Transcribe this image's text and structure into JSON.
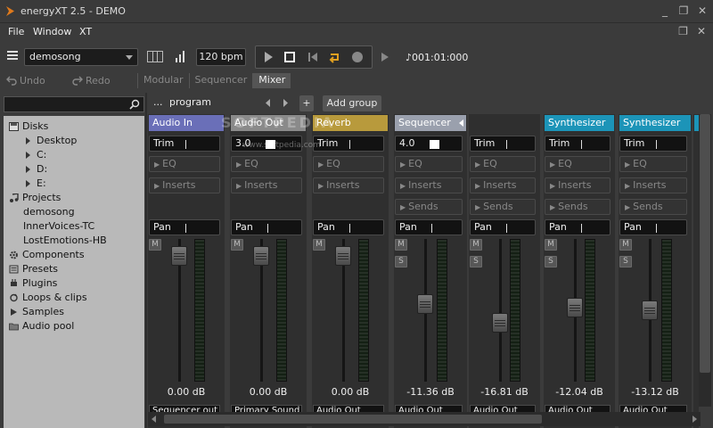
{
  "window": {
    "title": "energyXT 2.5 - DEMO",
    "minimize": "_",
    "restore": "❐",
    "close": "✕"
  },
  "menu": {
    "items": [
      "File",
      "Window",
      "XT"
    ]
  },
  "toolbar": {
    "song": "demosong",
    "bpm": "120 bpm",
    "position": "♪001:01:000"
  },
  "edit": {
    "undo": "Undo",
    "redo": "Redo"
  },
  "views": {
    "tabs": [
      "Modular",
      "Sequencer",
      "Mixer"
    ],
    "active": "Mixer"
  },
  "search": {
    "value": ""
  },
  "browser": {
    "items": [
      {
        "label": "Disks",
        "level": 0,
        "icon": "disk-icon"
      },
      {
        "label": "Desktop",
        "level": 1,
        "icon": "expand-arrow-icon"
      },
      {
        "label": "C:",
        "level": 1,
        "icon": "expand-arrow-icon"
      },
      {
        "label": "D:",
        "level": 1,
        "icon": "expand-arrow-icon"
      },
      {
        "label": "E:",
        "level": 1,
        "icon": "expand-arrow-icon"
      },
      {
        "label": "Projects",
        "level": 0,
        "icon": "music-note-icon"
      },
      {
        "label": "demosong",
        "level": 1,
        "icon": ""
      },
      {
        "label": "InnerVoices-TC",
        "level": 1,
        "icon": ""
      },
      {
        "label": "LostEmotions-HB",
        "level": 1,
        "icon": ""
      },
      {
        "label": "Components",
        "level": 0,
        "icon": "gear-icon"
      },
      {
        "label": "Presets",
        "level": 0,
        "icon": "list-icon"
      },
      {
        "label": "Plugins",
        "level": 0,
        "icon": "plug-icon"
      },
      {
        "label": "Loops & clips",
        "level": 0,
        "icon": "loop-icon"
      },
      {
        "label": "Samples",
        "level": 0,
        "icon": "play-icon"
      },
      {
        "label": "Audio pool",
        "level": 0,
        "icon": "folder-icon"
      }
    ]
  },
  "mixer": {
    "dots": "...",
    "program": "program",
    "plus": "+",
    "add_group": "Add group",
    "eq_label": "EQ",
    "inserts_label": "Inserts",
    "sends_label": "Sends",
    "pan_label": "Pan",
    "mute_label": "M",
    "solo_label": "S",
    "watermark": "SOFTPEDIA",
    "watermark_small": "www.softpedia.com",
    "strips": [
      {
        "name": "Audio In",
        "color": "#6a6fb8",
        "trim": "Trim",
        "db": "0.00 dB",
        "output": "Sequencer out",
        "level": 0.94,
        "sends": false
      },
      {
        "name": "Audio Out",
        "color": "#8a8a8a",
        "trim": "3.0",
        "db": "0.00 dB",
        "output": "Primary Sound Driver",
        "level": 0.94,
        "sends": false
      },
      {
        "name": "Reverb",
        "color": "#b89a3c",
        "trim": "Trim",
        "db": "0.00 dB",
        "output": "Audio Out",
        "level": 0.94,
        "sends": false
      },
      {
        "name": "Sequencer",
        "color": "#9aa0ad",
        "trim": "4.0",
        "db": "-11.36 dB",
        "output": "Audio Out",
        "level": 0.55,
        "sends": true
      },
      {
        "name": "",
        "color": "#2f2f2f",
        "trim": "Trim",
        "db": "-16.81 dB",
        "output": "Audio Out",
        "level": 0.4,
        "sends": true
      },
      {
        "name": "Synthesizer",
        "color": "#1c94b8",
        "trim": "Trim",
        "db": "-12.04 dB",
        "output": "Audio Out",
        "level": 0.52,
        "sends": true
      },
      {
        "name": "Synthesizer",
        "color": "#1c94b8",
        "trim": "Trim",
        "db": "-13.12 dB",
        "output": "Audio Out",
        "level": 0.5,
        "sends": true
      }
    ]
  }
}
